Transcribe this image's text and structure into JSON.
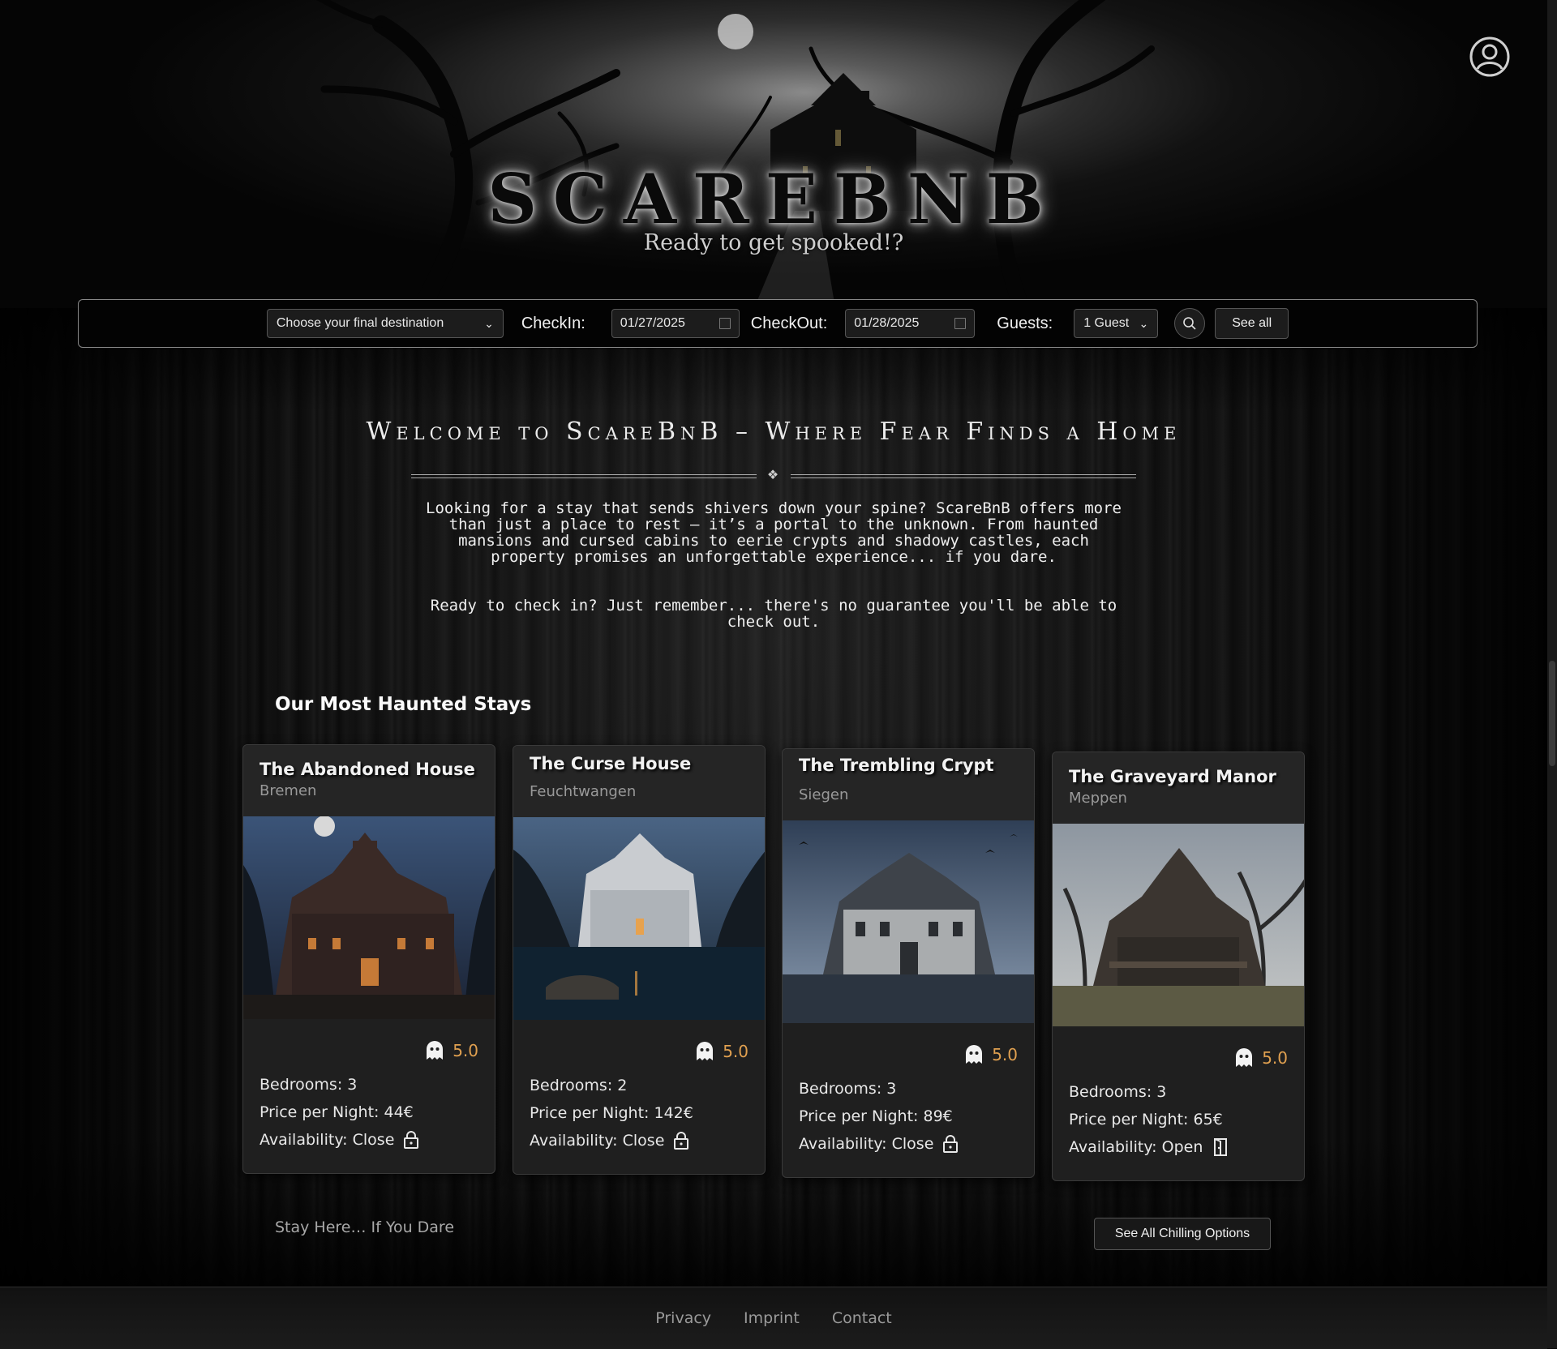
{
  "brand": {
    "logo": "SCAREBNB",
    "tagline": "Ready to get spooked!?"
  },
  "header": {
    "user_icon": "user-circle-icon"
  },
  "search": {
    "destination_value": "Choose your final destination",
    "checkin_label": "CheckIn:",
    "checkin_value": "01/27/2025",
    "checkout_label": "CheckOut:",
    "checkout_value": "01/28/2025",
    "guests_label": "Guests:",
    "guests_value": "1 Guest",
    "search_icon": "search-icon",
    "see_all_label": "See all"
  },
  "welcome": {
    "title": "Welcome to ScareBnB – Where Fear Finds a Home",
    "paragraph1_lines": [
      "Looking for a stay that sends shivers down your spine? ScareBnB offers more",
      "than just a place to rest – it’s a portal to the unknown. From haunted",
      "mansions and cursed cabins to eerie crypts and shadowy castles, each",
      "property promises an unforgettable experience... if you dare."
    ],
    "paragraph2_lines": [
      "Ready to check in? Just remember... there's no guarantee you'll be able to",
      "check out."
    ]
  },
  "stays": {
    "section_title": "Our Most Haunted Stays",
    "cards": [
      {
        "title": "The Abandoned House",
        "city": "Bremen",
        "rating": "5.0",
        "bedrooms": "Bedrooms: 3",
        "price": "Price per Night: 44€",
        "availability": "Availability: Close",
        "availability_icon": "lock-icon"
      },
      {
        "title": "The Curse House",
        "city": "Feuchtwangen",
        "rating": "5.0",
        "bedrooms": "Bedrooms: 2",
        "price": "Price per Night: 142€",
        "availability": "Availability: Close",
        "availability_icon": "lock-icon"
      },
      {
        "title": "The Trembling Crypt",
        "city": "Siegen",
        "rating": "5.0",
        "bedrooms": "Bedrooms: 3",
        "price": "Price per Night: 89€",
        "availability": "Availability: Close",
        "availability_icon": "lock-icon"
      },
      {
        "title": "The Graveyard Manor",
        "city": "Meppen",
        "rating": "5.0",
        "bedrooms": "Bedrooms: 3",
        "price": "Price per Night: 65€",
        "availability": "Availability: Open",
        "availability_icon": "open-door-icon"
      }
    ],
    "tagline": "Stay Here… If You Dare",
    "see_all_button": "See All Chilling Options"
  },
  "footer": {
    "links": [
      "Privacy",
      "Imprint",
      "Contact"
    ]
  },
  "colors": {
    "rating": "#e0a050",
    "background": "#070707",
    "card": "#1f1f1f"
  }
}
